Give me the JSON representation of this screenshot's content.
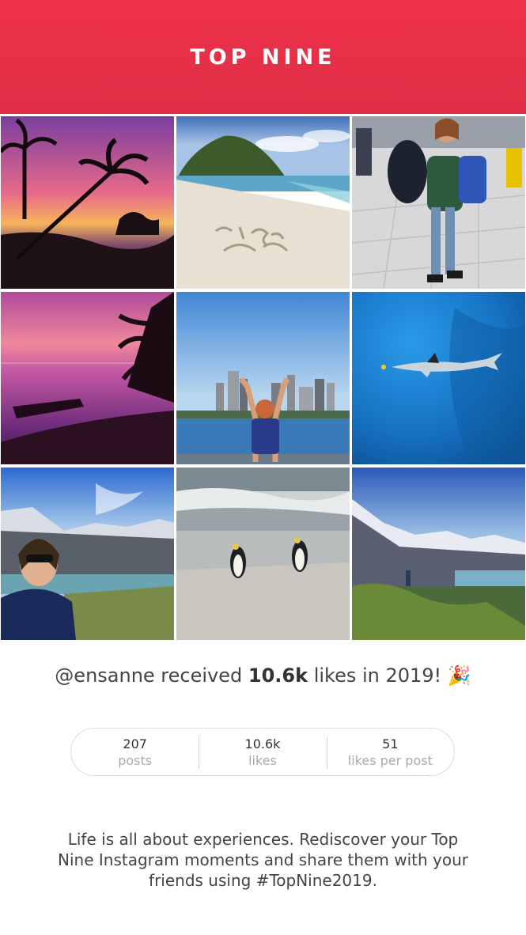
{
  "header": {
    "title": "TOP NINE"
  },
  "photos": [
    {
      "name": "sunset-palms-photo"
    },
    {
      "name": "beach-fiji-2019-photo"
    },
    {
      "name": "airport-backpacker-photo"
    },
    {
      "name": "purple-sunset-boat-photo"
    },
    {
      "name": "sydney-skyline-photo"
    },
    {
      "name": "shark-underwater-photo"
    },
    {
      "name": "mountain-selfie-photo"
    },
    {
      "name": "penguins-beach-photo"
    },
    {
      "name": "mountain-valley-photo"
    }
  ],
  "caption": {
    "prefix": "@ensanne received ",
    "highlight": "10.6k",
    "suffix": " likes in 2019! ",
    "emoji": "🎉"
  },
  "stats": [
    {
      "value": "207",
      "label": "posts"
    },
    {
      "value": "10.6k",
      "label": "likes"
    },
    {
      "value": "51",
      "label": "likes per post"
    }
  ],
  "blurb": "Life is all about experiences. Rediscover your Top Nine Instagram moments and share them with your friends using #TopNine2019.",
  "colors": {
    "header_gradient_start": "#ee3148",
    "header_gradient_end": "#e02f47"
  }
}
